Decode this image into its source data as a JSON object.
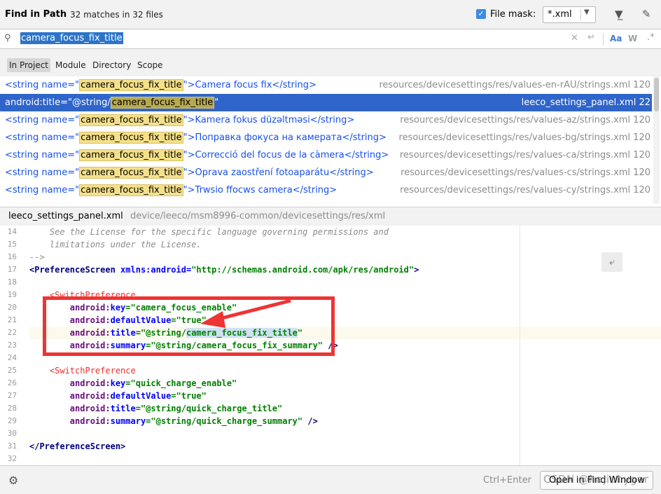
{
  "header": {
    "title": "Find in Path",
    "subtitle": "32 matches in 32 files",
    "file_mask_label": "File mask:",
    "file_mask_value": "*.xml"
  },
  "search": {
    "query": "camera_focus_fix_title"
  },
  "scopes": [
    "In Project",
    "Module",
    "Directory",
    "Scope"
  ],
  "results": [
    {
      "pre": "<string name=\"",
      "match": "camera_focus_fix_title",
      "post": "\">Camera focus fix</string>",
      "location": "resources/devicesettings/res/values-en-rAU/strings.xml 120"
    },
    {
      "pre": "android:title=\"@string/",
      "match": "camera_focus_fix_title",
      "post": "\"",
      "location": "leeco_settings_panel.xml 22",
      "selected": true
    },
    {
      "pre": "<string name=\"",
      "match": "camera_focus_fix_title",
      "post": "\">Kamera fokus düzəltməsi</string>",
      "location": "resources/devicesettings/res/values-az/strings.xml 120"
    },
    {
      "pre": "<string name=\"",
      "match": "camera_focus_fix_title",
      "post": "\">Поправка фокуса на камерата</string>",
      "location": "resources/devicesettings/res/values-bg/strings.xml 120"
    },
    {
      "pre": "<string name=\"",
      "match": "camera_focus_fix_title",
      "post": "\">Correcció del focus de la càmera</string>",
      "location": "resources/devicesettings/res/values-ca/strings.xml 120"
    },
    {
      "pre": "<string name=\"",
      "match": "camera_focus_fix_title",
      "post": "\">Oprava zaostření fotoaparátu</string>",
      "location": "resources/devicesettings/res/values-cs/strings.xml 120"
    },
    {
      "pre": "<string name=\"",
      "match": "camera_focus_fix_title",
      "post": "\">Trwsio ffocws camera</string>",
      "location": "resources/devicesettings/res/values-cy/strings.xml 120"
    }
  ],
  "preview": {
    "file": "leeco_settings_panel.xml",
    "path": "device/leeco/msm8996-common/devicesettings/res/xml"
  },
  "editor": {
    "line_numbers": [
      "14",
      "15",
      "16",
      "17",
      "18",
      "19",
      "20",
      "21",
      "22",
      "23",
      "24",
      "25",
      "26",
      "27",
      "28",
      "29",
      "30",
      "31",
      "32"
    ],
    "lines": {
      "l14": "    See the License for the specific language governing permissions and",
      "l15": "    limitations under the License.",
      "l16": "-->",
      "l17_tag": "<PreferenceScreen",
      "l17_attr": " xmlns:android=",
      "l17_val": "\"http://schemas.android.com/apk/res/android\"",
      "l17_end": ">",
      "l19": "    <SwitchPreference",
      "l20_ns": "        android:",
      "l20_attr": "key",
      "l20_val": "=\"camera_focus_enable\"",
      "l21_ns": "        android:",
      "l21_attr": "defaultValue",
      "l21_val": "=\"true\"",
      "l22_ns": "        android:",
      "l22_attr": "title",
      "l22_val_pre": "=\"@string/",
      "l22_val_hl": "camera_focus_fix_title",
      "l22_val_post": "\"",
      "l23_ns": "        android:",
      "l23_attr": "summary",
      "l23_val": "=\"@string/camera_focus_fix_summary\"",
      "l23_end": " />",
      "l25": "    <SwitchPreference",
      "l26_ns": "        android:",
      "l26_attr": "key",
      "l26_val": "=\"quick_charge_enable\"",
      "l27_ns": "        android:",
      "l27_attr": "defaultValue",
      "l27_val": "=\"true\"",
      "l28_ns": "        android:",
      "l28_attr": "title",
      "l28_val": "=\"@string/quick_charge_title\"",
      "l29_ns": "        android:",
      "l29_attr": "summary",
      "l29_val": "=\"@string/quick_charge_summary\"",
      "l29_end": " />",
      "l31": "</PreferenceScreen>"
    }
  },
  "footer": {
    "shortcut": "Ctrl+Enter",
    "open_button": "Open in Find Window",
    "watermark": "CSDN @hajiuhyger"
  }
}
